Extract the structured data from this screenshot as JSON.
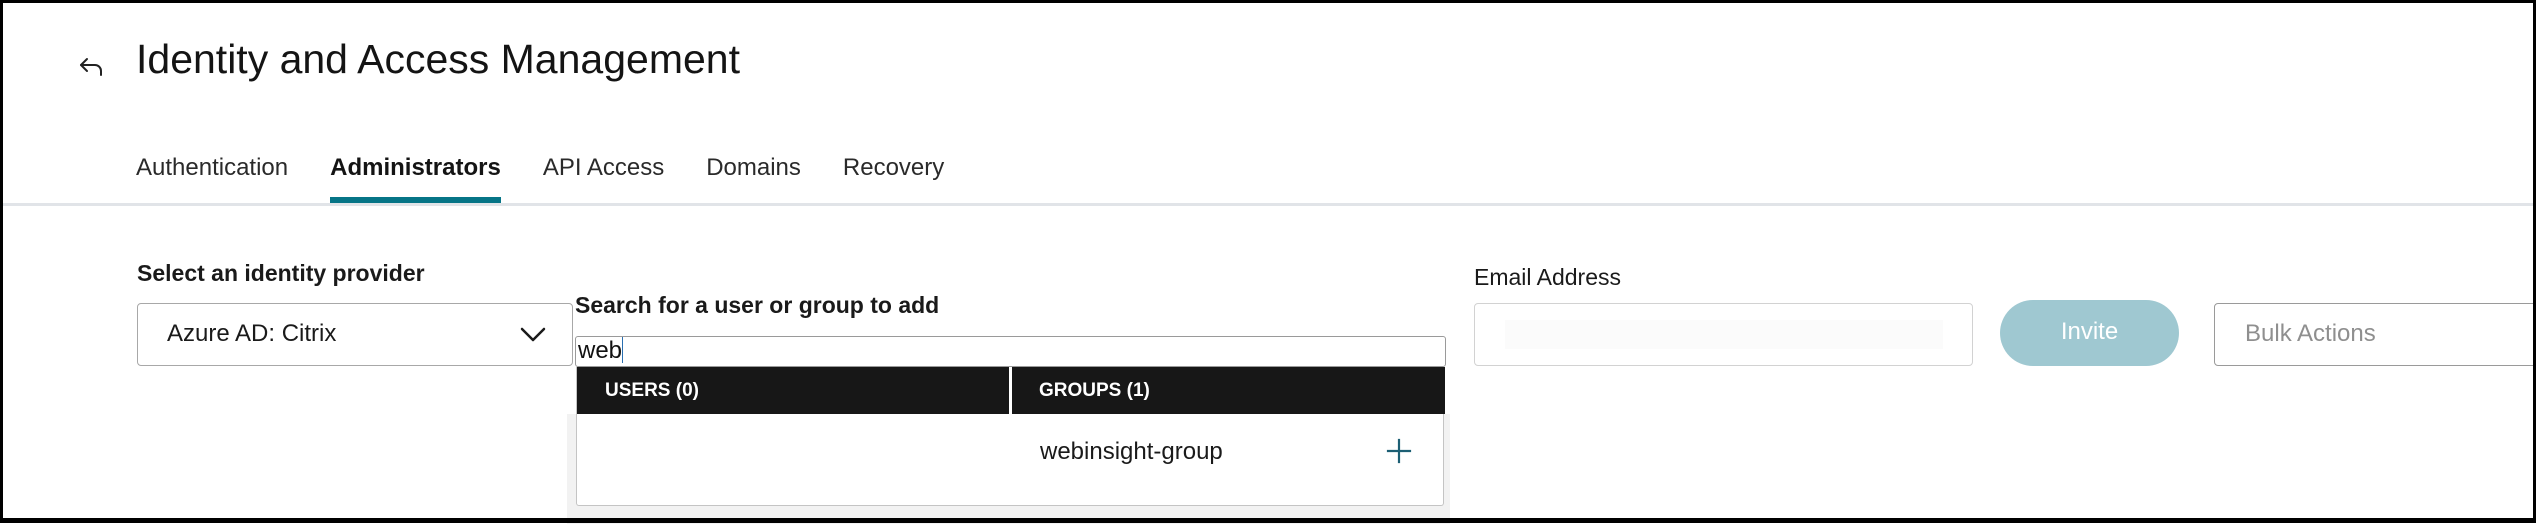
{
  "header": {
    "back_icon": "back-arrow-icon",
    "title": "Identity and Access Management"
  },
  "tabs": [
    {
      "label": "Authentication",
      "active": false
    },
    {
      "label": "Administrators",
      "active": true
    },
    {
      "label": "API Access",
      "active": false
    },
    {
      "label": "Domains",
      "active": false
    },
    {
      "label": "Recovery",
      "active": false
    }
  ],
  "colors": {
    "accent": "#067587",
    "invite_disabled": "#9fc8d1",
    "dropdown_header": "#171717"
  },
  "identity_provider": {
    "label": "Select an identity provider",
    "selected": "Azure AD: Citrix",
    "icon": "chevron-down-icon"
  },
  "search": {
    "label": "Search for a user or group to add",
    "value": "web",
    "results": {
      "users_header": "USERS (0)",
      "groups_header": "GROUPS (1)",
      "users": [],
      "groups": [
        {
          "name": "webinsight-group",
          "action_icon": "plus-icon"
        }
      ]
    }
  },
  "email": {
    "label": "Email Address",
    "value": ""
  },
  "invite_button": {
    "label": "Invite",
    "disabled": true
  },
  "bulk_actions": {
    "placeholder": "Bulk Actions"
  }
}
